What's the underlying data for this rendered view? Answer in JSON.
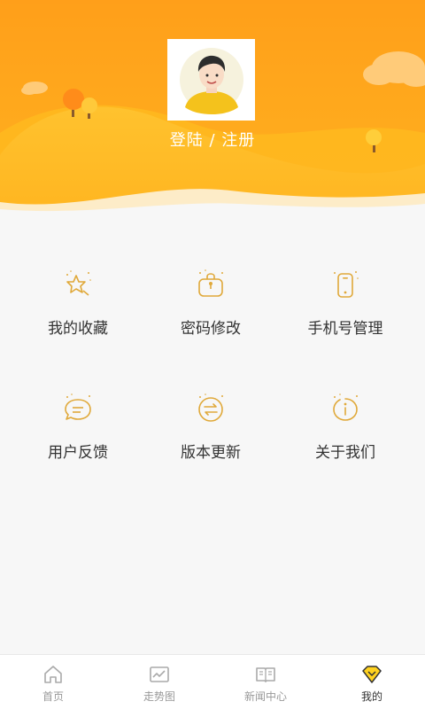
{
  "header": {
    "login_label": "登陆 / 注册",
    "accent": "#f5a623"
  },
  "grid": {
    "items": [
      {
        "label": "我的收藏",
        "icon": "favorites-star-icon"
      },
      {
        "label": "密码修改",
        "icon": "password-lock-icon"
      },
      {
        "label": "手机号管理",
        "icon": "phone-icon"
      },
      {
        "label": "用户反馈",
        "icon": "feedback-chat-icon"
      },
      {
        "label": "版本更新",
        "icon": "version-update-icon"
      },
      {
        "label": "关于我们",
        "icon": "about-info-icon"
      }
    ],
    "icon_color": "#e0a93a"
  },
  "tabbar": {
    "tabs": [
      {
        "label": "首页",
        "icon": "home-icon",
        "active": false
      },
      {
        "label": "走势图",
        "icon": "trend-chart-icon",
        "active": false
      },
      {
        "label": "新闻中心",
        "icon": "news-book-icon",
        "active": false
      },
      {
        "label": "我的",
        "icon": "profile-diamond-icon",
        "active": true
      }
    ]
  }
}
